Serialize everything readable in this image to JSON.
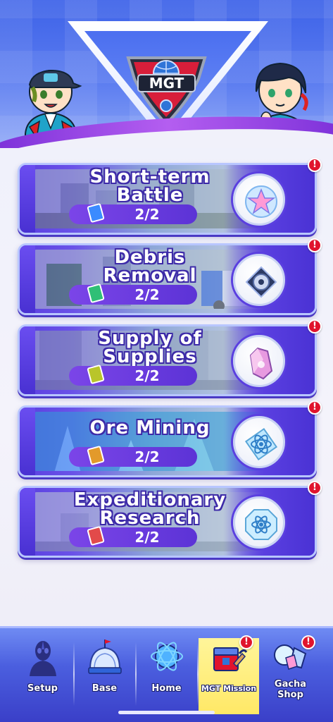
{
  "header": {
    "logo_text": "MGT"
  },
  "missions": [
    {
      "title": "Short-term\nBattle",
      "count": "2/2",
      "ticket_color": "#3b8bff",
      "reward_icon": "star-crystal-icon",
      "badge": "!"
    },
    {
      "title": "Debris\nRemoval",
      "count": "2/2",
      "ticket_color": "#2fbf76",
      "reward_icon": "disk-part-icon",
      "badge": "!"
    },
    {
      "title": "Supply of\nSupplies",
      "count": "2/2",
      "ticket_color": "#b9c52a",
      "reward_icon": "pink-crystal-icon",
      "badge": "!"
    },
    {
      "title": "Ore Mining",
      "count": "2/2",
      "ticket_color": "#e39a2b",
      "reward_icon": "atom-ore-icon",
      "badge": "!"
    },
    {
      "title": "Expeditionary\nResearch",
      "count": "2/2",
      "ticket_color": "#e24a4a",
      "reward_icon": "atom-shield-icon",
      "badge": "!"
    }
  ],
  "nav": {
    "items": [
      {
        "label": "Setup",
        "icon": "ultraman-silhouette-icon"
      },
      {
        "label": "Base",
        "icon": "dome-base-icon"
      },
      {
        "label": "Home",
        "icon": "globe-atom-icon"
      },
      {
        "label": "MGT Mission",
        "icon": "mission-box-icon",
        "active": true,
        "badge": "!"
      },
      {
        "label": "Gacha\nShop",
        "icon": "gems-icon",
        "badge": "!"
      }
    ]
  },
  "colors": {
    "accent": "#5a3fe0",
    "badge": "#e0142d",
    "active_tab": "#ffe866"
  }
}
